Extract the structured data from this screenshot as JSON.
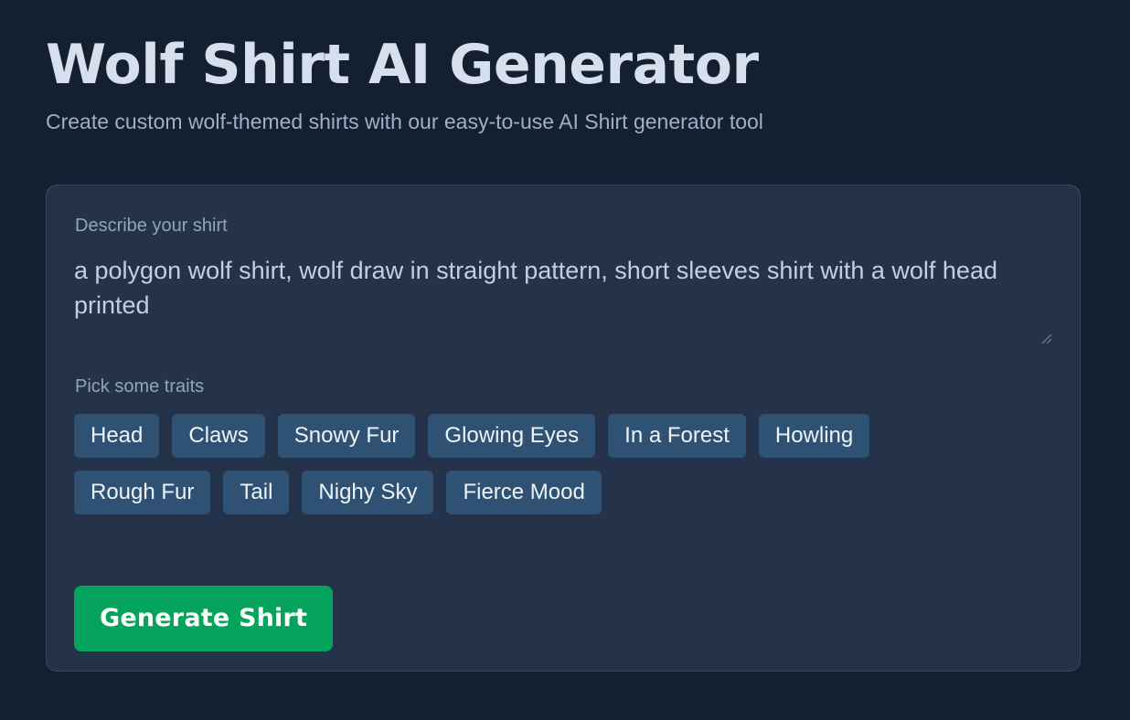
{
  "header": {
    "title": "Wolf Shirt AI Generator",
    "subtitle": "Create custom wolf-themed shirts with our easy-to-use AI Shirt generator tool"
  },
  "form": {
    "prompt_label": "Describe your shirt",
    "prompt_value": "a polygon wolf shirt, wolf draw in straight pattern, short sleeves shirt with a wolf head printed ",
    "prompt_placeholder": "Describe your shirt",
    "traits_label": "Pick some traits",
    "traits": [
      {
        "label": "Head",
        "selected": false
      },
      {
        "label": "Claws",
        "selected": false
      },
      {
        "label": "Snowy Fur",
        "selected": false
      },
      {
        "label": "Glowing Eyes",
        "selected": false
      },
      {
        "label": "In a Forest",
        "selected": false
      },
      {
        "label": "Howling",
        "selected": false
      },
      {
        "label": "Rough Fur",
        "selected": false
      },
      {
        "label": "Tail",
        "selected": false
      },
      {
        "label": "Nighy Sky",
        "selected": false
      },
      {
        "label": "Fierce Mood",
        "selected": false
      }
    ],
    "generate_label": "Generate Shirt"
  },
  "icons": {
    "resize_grip": "resize-grip-icon"
  },
  "colors": {
    "page_background": "#141f32",
    "card_background": "#25334a",
    "card_border": "#36455e",
    "title": "#d6e0ec",
    "subtitle": "#9fb0c4",
    "label": "#93a4b8",
    "prompt_text": "#c2d0de",
    "chip_background": "#2f5274",
    "chip_text": "#eef3f8",
    "accent_green": "#04a45c",
    "button_text": "#ffffff"
  }
}
